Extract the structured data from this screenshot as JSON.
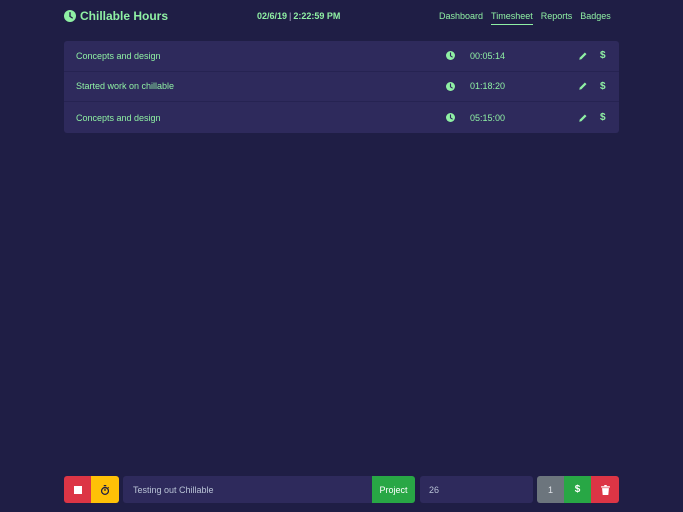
{
  "app": {
    "title": "Chillable Hours",
    "accent_color": "#8ff0a4",
    "background_color": "#1f1e45"
  },
  "header": {
    "date": "02/6/19",
    "separator": "|",
    "time": "2:22:59 PM",
    "nav": [
      {
        "label": "Dashboard",
        "active": false
      },
      {
        "label": "Timesheet",
        "active": true
      },
      {
        "label": "Reports",
        "active": false
      },
      {
        "label": "Badges",
        "active": false
      }
    ]
  },
  "entries": [
    {
      "description": "Concepts and design",
      "duration": "00:05:14",
      "icons": [
        "clock-icon",
        "pencil-icon",
        "dollar-icon"
      ]
    },
    {
      "description": "Started work on chillable",
      "duration": "01:18:20",
      "icons": [
        "clock-icon",
        "pencil-icon",
        "dollar-icon"
      ]
    },
    {
      "description": "Concepts and design",
      "duration": "05:15:00",
      "icons": [
        "clock-icon",
        "pencil-icon",
        "dollar-icon"
      ]
    }
  ],
  "timer_bar": {
    "stop_icon": "stop-icon",
    "stopwatch_icon": "stopwatch-icon",
    "task_value": "Testing out Chillable",
    "project_label": "Project",
    "number_value": "26",
    "count_label": "1",
    "bill_label": "$",
    "delete_icon": "trash-icon"
  },
  "colors": {
    "danger": "#dc3545",
    "warning": "#ffc107",
    "success": "#28a745",
    "secondary": "#6c757d",
    "panel": "#2e2a5c"
  }
}
